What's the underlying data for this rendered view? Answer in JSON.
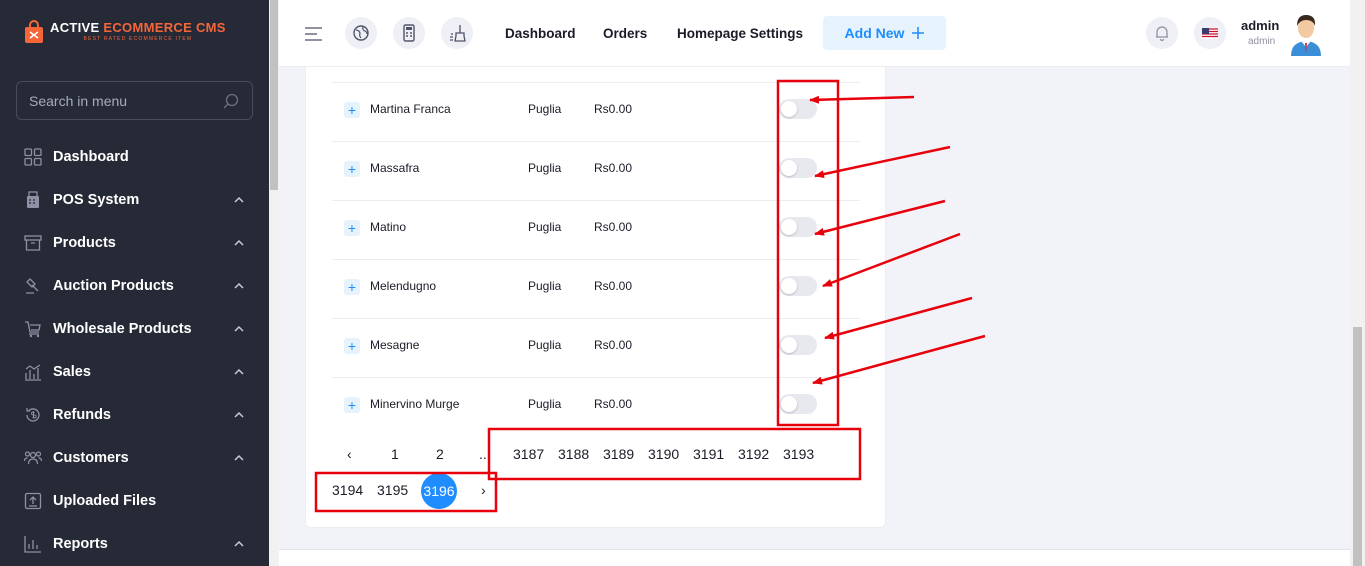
{
  "brand": {
    "name_part1": "ACTIVE ",
    "name_part2": "ECOMMERCE CMS",
    "tagline": "BEST RATED ECOMMERCE ITEM"
  },
  "sidebar": {
    "search_placeholder": "Search in menu",
    "items": [
      {
        "label": "Dashboard",
        "icon": "dashboard-icon",
        "has_chevron": false
      },
      {
        "label": "POS System",
        "icon": "pos-icon",
        "has_chevron": true
      },
      {
        "label": "Products",
        "icon": "box-icon",
        "has_chevron": true
      },
      {
        "label": "Auction Products",
        "icon": "gavel-icon",
        "has_chevron": true
      },
      {
        "label": "Wholesale Products",
        "icon": "cart-icon",
        "has_chevron": true
      },
      {
        "label": "Sales",
        "icon": "sales-chart-icon",
        "has_chevron": true
      },
      {
        "label": "Refunds",
        "icon": "refund-icon",
        "has_chevron": true
      },
      {
        "label": "Customers",
        "icon": "users-icon",
        "has_chevron": true
      },
      {
        "label": "Uploaded Files",
        "icon": "upload-icon",
        "has_chevron": false
      },
      {
        "label": "Reports",
        "icon": "bar-chart-icon",
        "has_chevron": true
      }
    ]
  },
  "topbar": {
    "nav": [
      "Dashboard",
      "Orders",
      "Homepage Settings"
    ],
    "add_new_label": "Add New",
    "user_name": "admin",
    "user_role": "admin"
  },
  "cities": [
    {
      "name": "Martina Franca",
      "state": "Puglia",
      "cost": "Rs0.00",
      "enabled": false
    },
    {
      "name": "Massafra",
      "state": "Puglia",
      "cost": "Rs0.00",
      "enabled": false
    },
    {
      "name": "Matino",
      "state": "Puglia",
      "cost": "Rs0.00",
      "enabled": false
    },
    {
      "name": "Melendugno",
      "state": "Puglia",
      "cost": "Rs0.00",
      "enabled": false
    },
    {
      "name": "Mesagne",
      "state": "Puglia",
      "cost": "Rs0.00",
      "enabled": false
    },
    {
      "name": "Minervino Murge",
      "state": "Puglia",
      "cost": "Rs0.00",
      "enabled": false
    }
  ],
  "pagination": {
    "prev": "‹",
    "next": "›",
    "ellipsis": "...",
    "pages_row1": [
      "1",
      "2"
    ],
    "pages_row1_tail": [
      "3187",
      "3188",
      "3189",
      "3190",
      "3191",
      "3192",
      "3193"
    ],
    "pages_row2": [
      "3194",
      "3195"
    ],
    "current": "3196"
  },
  "colors": {
    "sidebar_bg": "#262a36",
    "accent": "#1f8dff",
    "brand_orange": "#f4663a",
    "annotation_red": "#e8000b"
  }
}
